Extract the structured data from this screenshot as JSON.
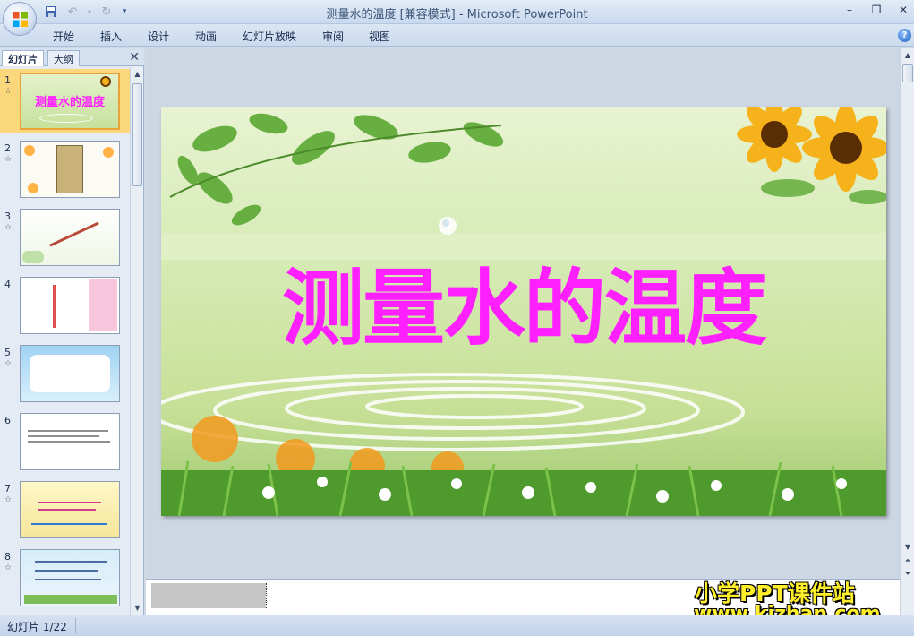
{
  "window": {
    "title": "测量水的温度 [兼容模式] - Microsoft PowerPoint"
  },
  "quick_access": {
    "save_icon": "save-icon",
    "undo_icon": "undo-icon",
    "redo_icon": "redo-icon",
    "customize_icon": "customize-qat-icon"
  },
  "ribbon": {
    "tabs": [
      "开始",
      "插入",
      "设计",
      "动画",
      "幻灯片放映",
      "审阅",
      "视图"
    ],
    "help_label": "?"
  },
  "panel": {
    "tab_slides": "幻灯片",
    "tab_outline": "大纲",
    "close_label": "✕"
  },
  "thumbnails": [
    {
      "number": "1",
      "title": "测量水的温度",
      "has_animation": true
    },
    {
      "number": "2",
      "has_animation": true
    },
    {
      "number": "3",
      "has_animation": true
    },
    {
      "number": "4",
      "has_animation": false
    },
    {
      "number": "5",
      "has_animation": true
    },
    {
      "number": "6",
      "has_animation": false
    },
    {
      "number": "7",
      "has_animation": true
    },
    {
      "number": "8",
      "has_animation": true
    }
  ],
  "slide": {
    "title": "测量水的温度"
  },
  "status": {
    "slide_indicator": "幻灯片 1/22"
  },
  "watermark": {
    "line1": "小学PPT课件站",
    "line2": "www.kjzhan.com"
  },
  "colors": {
    "title_magenta": "#ff20ff",
    "watermark_yellow": "#ffef2a",
    "selected_thumb": "#fbd77c"
  }
}
